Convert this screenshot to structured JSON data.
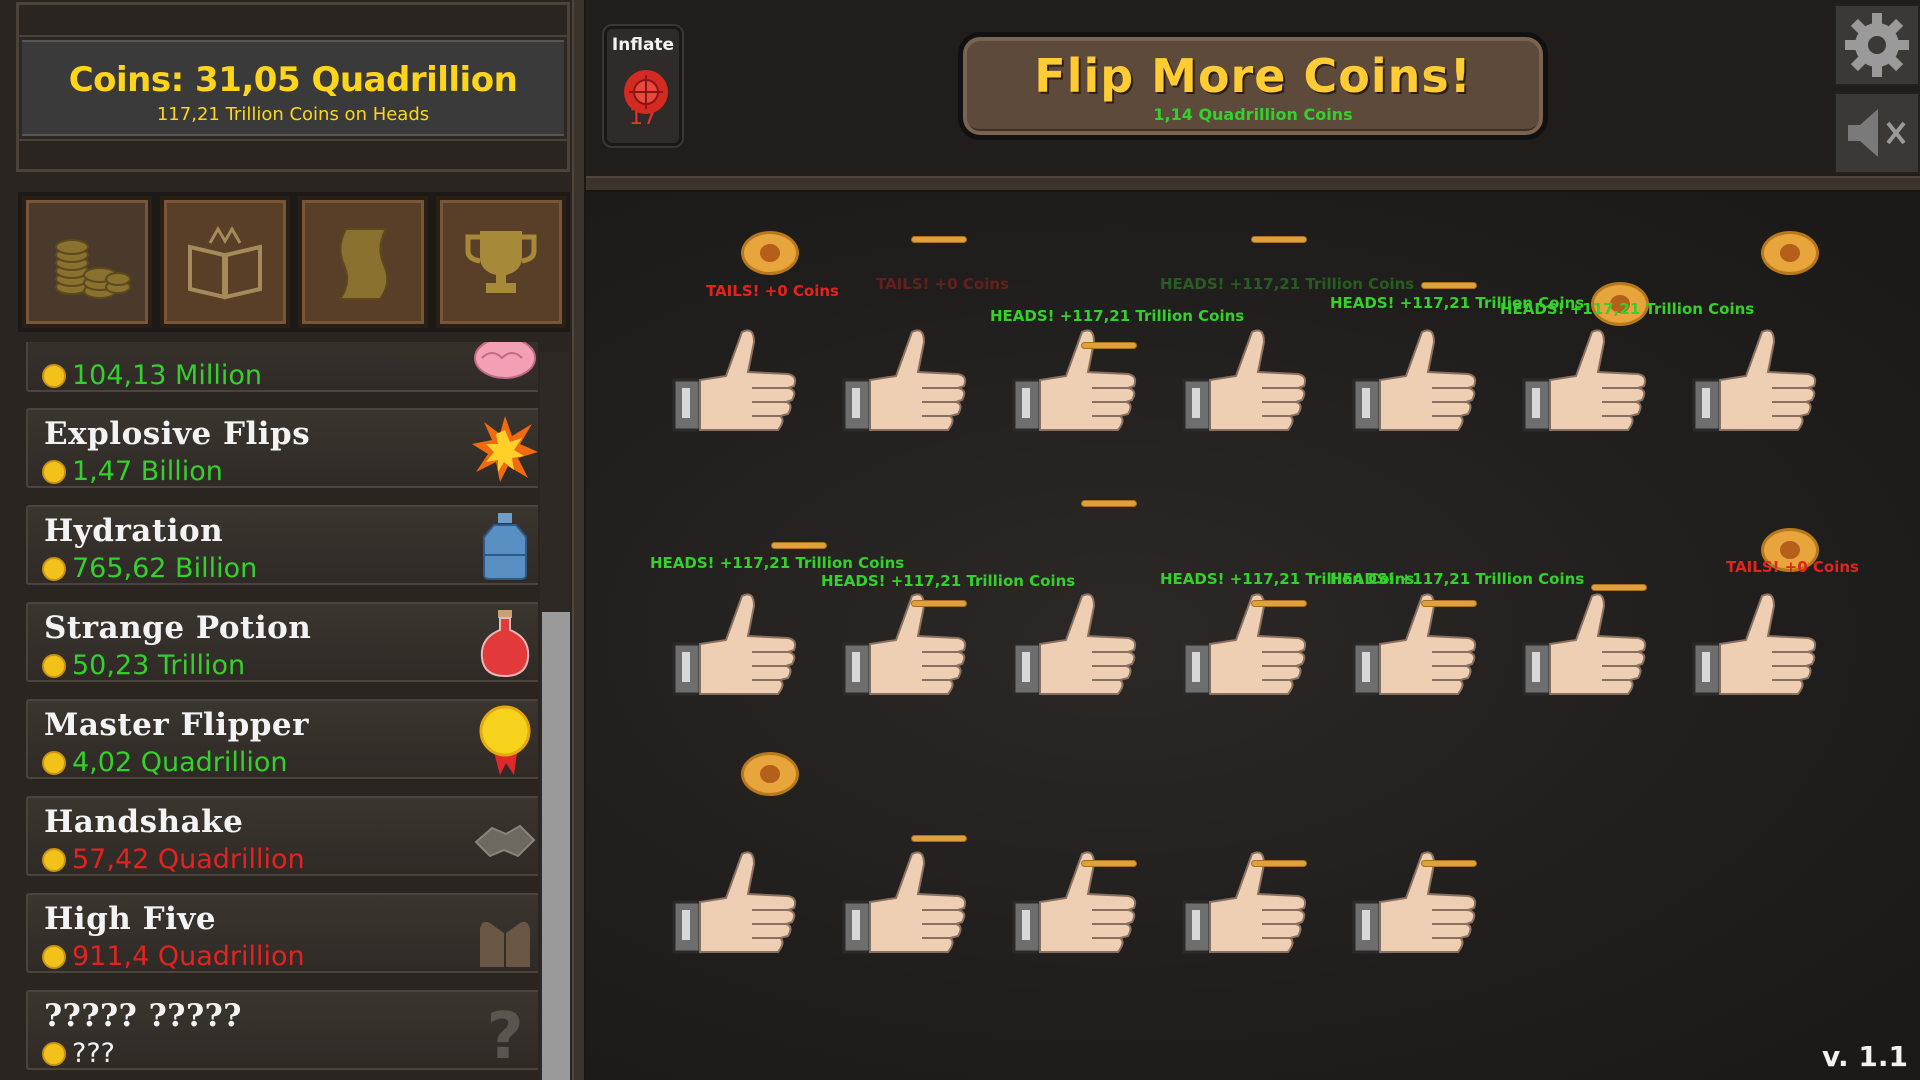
{
  "coin_display": {
    "title": "Coins: 31,05 Quadrillion",
    "subtitle": "117,21 Trillion Coins on Heads"
  },
  "tabs": [
    {
      "icon": "coin-stack-icon"
    },
    {
      "icon": "book-icon"
    },
    {
      "icon": "scroll-icon"
    },
    {
      "icon": "trophy-icon"
    }
  ],
  "shop": {
    "items": [
      {
        "name": "",
        "price": "104,13 Million",
        "affordable": true,
        "icon": "brain-icon"
      },
      {
        "name": "Explosive Flips",
        "price": "1,47 Billion",
        "affordable": true,
        "icon": "explosion-icon"
      },
      {
        "name": "Hydration",
        "price": "765,62 Billion",
        "affordable": true,
        "icon": "water-jug-icon"
      },
      {
        "name": "Strange Potion",
        "price": "50,23 Trillion",
        "affordable": true,
        "icon": "potion-icon"
      },
      {
        "name": "Master Flipper",
        "price": "4,02 Quadrillion",
        "affordable": true,
        "icon": "medal-icon"
      },
      {
        "name": "Handshake",
        "price": "57,42 Quadrillion",
        "affordable": false,
        "icon": "handshake-icon"
      },
      {
        "name": "High Five",
        "price": "911,4 Quadrillion",
        "affordable": false,
        "icon": "high-five-icon"
      },
      {
        "name": "????? ?????",
        "price": "???",
        "affordable": false,
        "icon": "question-mark-icon"
      }
    ]
  },
  "inflate": {
    "title": "Inflate",
    "count": "17"
  },
  "flip_button": {
    "title": "Flip More Coins!",
    "subtitle": "1,14 Quadrillion Coins"
  },
  "version": "v. 1.1",
  "float_texts": [
    "TAILS! +0 Coins",
    "HEADS! +117,21 Trillion Coins"
  ],
  "colors": {
    "gold": "#ffd51c",
    "heads_green": "#34d12c",
    "tails_red": "#e2231f",
    "button_brown": "#5d4a3a"
  }
}
